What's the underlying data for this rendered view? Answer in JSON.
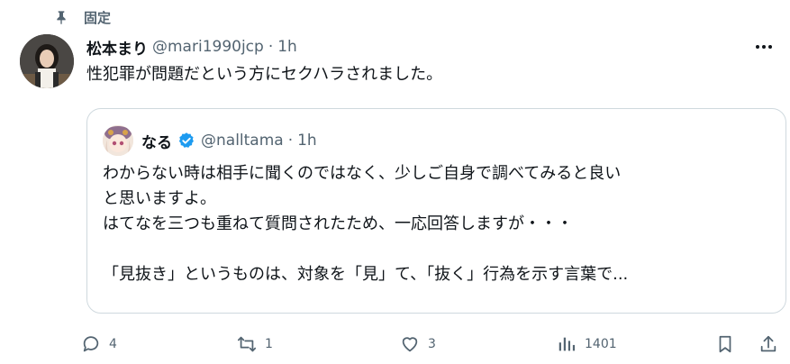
{
  "pinned": {
    "label": "固定",
    "icon": "pin-icon"
  },
  "author": {
    "display_name": "松本まり",
    "handle": "@mari1990jcp",
    "separator": "·",
    "time": "1h",
    "avatar": "avatar"
  },
  "tweet": {
    "text": "性犯罪が問題だという方にセクハラされました。"
  },
  "quote": {
    "display_name": "なる",
    "verified": true,
    "handle": "@nalltama",
    "separator": "·",
    "time": "1h",
    "lines": [
      "わからない時は相手に聞くのではなく、少しご自身で調べてみると良い",
      "と思いますよ。",
      "はてなを三つも重ねて質問されたため、一応回答しますが・・・",
      "",
      "「見抜き」というものは、対象を「見」て、「抜く」行為を示す言葉で..."
    ]
  },
  "actions": {
    "reply": {
      "icon": "reply-icon",
      "count": "4"
    },
    "repost": {
      "icon": "repost-icon",
      "count": "1"
    },
    "like": {
      "icon": "heart-icon",
      "count": "3"
    },
    "views": {
      "icon": "views-icon",
      "count": "1401"
    },
    "bookmark": {
      "icon": "bookmark-icon"
    },
    "share": {
      "icon": "share-icon"
    }
  },
  "colors": {
    "text": "#0f1419",
    "secondary": "#536471",
    "border": "#cfd9de",
    "verified": "#1d9bf0"
  }
}
